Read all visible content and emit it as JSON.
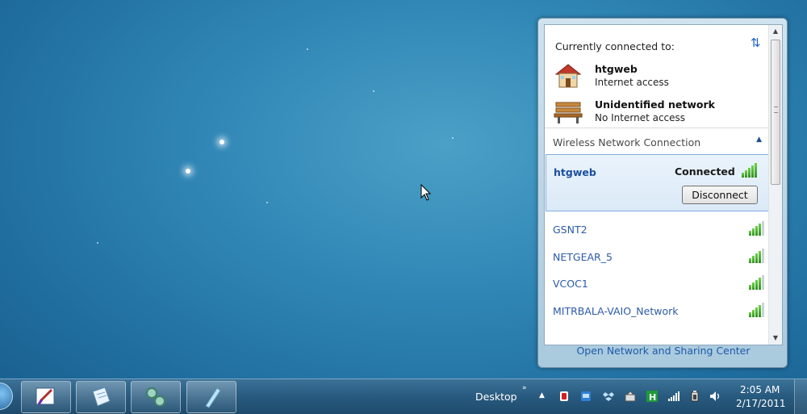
{
  "popup": {
    "header": "Currently connected to:",
    "connections": [
      {
        "name": "htgweb",
        "status": "Internet access",
        "icon": "home-network-icon"
      },
      {
        "name": "Unidentified network",
        "status": "No Internet access",
        "icon": "park-bench-network-icon"
      }
    ],
    "section_title": "Wireless Network Connection",
    "selected_network": {
      "name": "htgweb",
      "status": "Connected",
      "button_label": "Disconnect",
      "signal_bars": 5
    },
    "networks": [
      {
        "name": "GSNT2",
        "signal_bars": 4
      },
      {
        "name": "NETGEAR_5",
        "signal_bars": 4
      },
      {
        "name": "VCOC1",
        "signal_bars": 4
      },
      {
        "name": "MITRBALA-VAIO_Network",
        "signal_bars": 4
      }
    ],
    "footer_link": "Open Network and Sharing Center"
  },
  "taskbar": {
    "buttons": [
      "paint-icon",
      "notepad-icon",
      "network-icon",
      "marker-icon"
    ],
    "desktop_label": "Desktop",
    "tray_icons": [
      "antivirus-icon",
      "windows-live-icon",
      "dropbox-icon",
      "removable-device-icon",
      "h-app-icon",
      "network-signal-icon",
      "power-icon",
      "volume-icon"
    ],
    "time": "2:05 AM",
    "date": "2/17/2011"
  },
  "colors": {
    "link": "#1e5aa8",
    "signal_green": "#3aa82a",
    "taskbar": "#285a7f",
    "selected_border": "#84acdd"
  }
}
